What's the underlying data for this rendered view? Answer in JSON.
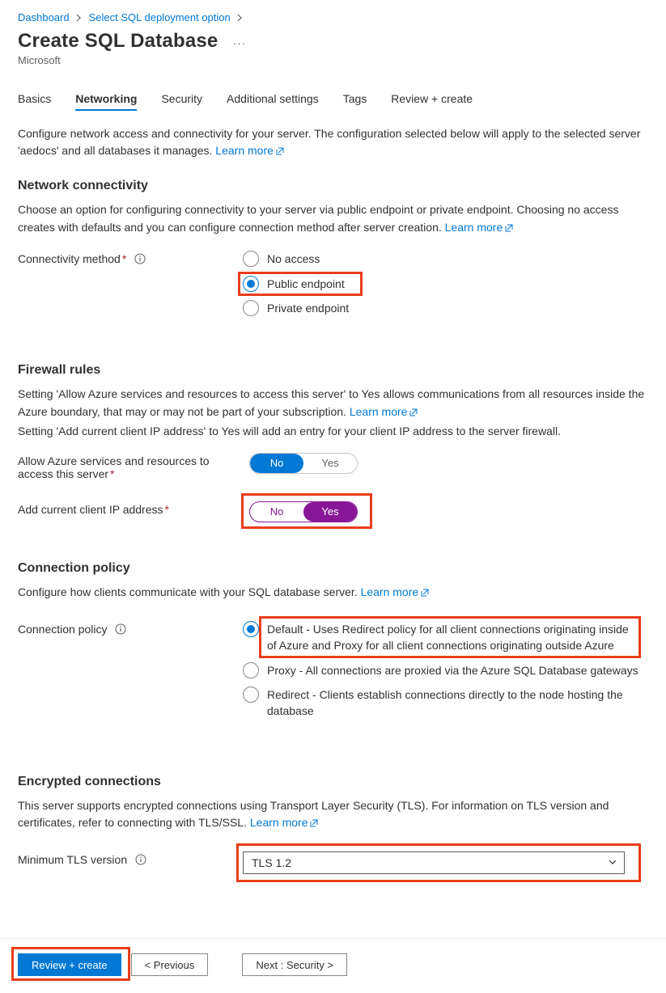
{
  "breadcrumb": {
    "items": [
      "Dashboard",
      "Select SQL deployment option"
    ]
  },
  "page": {
    "title": "Create SQL Database",
    "vendor": "Microsoft"
  },
  "tabs": [
    {
      "label": "Basics",
      "active": false
    },
    {
      "label": "Networking",
      "active": true
    },
    {
      "label": "Security",
      "active": false
    },
    {
      "label": "Additional settings",
      "active": false
    },
    {
      "label": "Tags",
      "active": false
    },
    {
      "label": "Review + create",
      "active": false
    }
  ],
  "intro": {
    "text": "Configure network access and connectivity for your server. The configuration selected below will apply to the selected server 'aedocs' and all databases it manages.",
    "learn_more": "Learn more"
  },
  "network_connectivity": {
    "heading": "Network connectivity",
    "desc": "Choose an option for configuring connectivity to your server via public endpoint or private endpoint. Choosing no access creates with defaults and you can configure connection method after server creation.",
    "learn_more": "Learn more",
    "label": "Connectivity method",
    "options": [
      {
        "label": "No access"
      },
      {
        "label": "Public endpoint"
      },
      {
        "label": "Private endpoint"
      }
    ],
    "selected": "Public endpoint"
  },
  "firewall": {
    "heading": "Firewall rules",
    "desc1_a": "Setting 'Allow Azure services and resources to access this server' to Yes allows communications from all resources inside the Azure boundary, that may or may not be part of your subscription.",
    "learn_more": "Learn more",
    "desc2": "Setting 'Add current client IP address' to Yes will add an entry for your client IP address to the server firewall.",
    "rows": [
      {
        "label": "Allow Azure services and resources to access this server",
        "no": "No",
        "yes": "Yes",
        "value": "No",
        "style": "blue"
      },
      {
        "label": "Add current client IP address",
        "no": "No",
        "yes": "Yes",
        "value": "Yes",
        "style": "purple"
      }
    ]
  },
  "connection_policy": {
    "heading": "Connection policy",
    "desc": "Configure how clients communicate with your SQL database server.",
    "learn_more": "Learn more",
    "label": "Connection policy",
    "options": [
      {
        "label": "Default - Uses Redirect policy for all client connections originating inside of Azure and Proxy for all client connections originating outside Azure"
      },
      {
        "label": "Proxy - All connections are proxied via the Azure SQL Database gateways"
      },
      {
        "label": "Redirect - Clients establish connections directly to the node hosting the database"
      }
    ],
    "selected_index": 0
  },
  "encrypted": {
    "heading": "Encrypted connections",
    "desc": "This server supports encrypted connections using Transport Layer Security (TLS). For information on TLS version and certificates, refer to connecting with TLS/SSL.",
    "learn_more": "Learn more",
    "label": "Minimum TLS version",
    "value": "TLS 1.2"
  },
  "footer": {
    "review_create": "Review + create",
    "previous": "< Previous",
    "next": "Next : Security >"
  }
}
